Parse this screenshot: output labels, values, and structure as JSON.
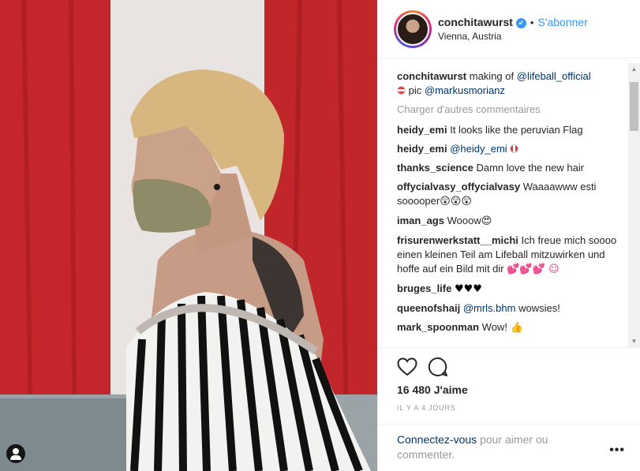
{
  "post": {
    "username": "conchitawurst",
    "verified_mark": "✔",
    "separator": "•",
    "follow_label": "S'abonner",
    "location": "Vienna, Austria"
  },
  "caption": {
    "user": "conchitawurst",
    "text": "making of",
    "mention1": "@lifeball_official",
    "text2": "pic",
    "mention2": "@markusmorianz"
  },
  "load_more": "Charger d'autres commentaires",
  "comments": [
    {
      "user": "heidy_emi",
      "text": "It looks like the peruvian Flag"
    },
    {
      "user": "heidy_emi",
      "mention": "@heidy_emi"
    },
    {
      "user": "thanks_science",
      "text": "Damn love the new hair"
    },
    {
      "user": "offycialvasy_offycialvasy",
      "text": "Waaaawww esti sooooper",
      "emoji": "😲😲😲"
    },
    {
      "user": "iman_ags",
      "text": "Wooow",
      "emoji": "😍"
    },
    {
      "user": "frisurenwerkstatt__michi",
      "text": "Ich freue mich soooo einen kleinen Teil am Lifeball mitzuwirken und hoffe auf ein Bild mit dir",
      "emoji": "💕💕💕 ☺"
    },
    {
      "user": "bruges_life",
      "emoji": "♥♥♥"
    },
    {
      "user": "queenofshaij",
      "mention": "@mrls.bhm",
      "text": "wowsies!"
    },
    {
      "user": "mark_spoonman",
      "text": "Wow!",
      "emoji": "👍"
    }
  ],
  "likes": "16 480 J'aime",
  "time_ago": "IL Y A 4 JOURS",
  "footer": {
    "login_link": "Connectez-vous",
    "login_text": "pour aimer ou commenter."
  },
  "more_label": "•••",
  "colors": {
    "accent": "#3897f0",
    "link": "#003569",
    "muted": "#999999",
    "flag_red": "#c22a2a"
  },
  "icons": [
    "heart-icon",
    "comment-icon",
    "user-tag-icon",
    "verified-badge-icon"
  ]
}
